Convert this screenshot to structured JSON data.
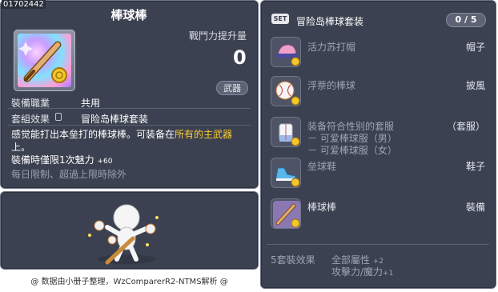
{
  "item_id": "01702442",
  "item": {
    "title": "棒球棒",
    "power_label": "戰鬥力提升量",
    "power_value": "0",
    "weapon_badge": "武器",
    "job_label": "裝備職業",
    "job_value": "共用",
    "set_label": "套組效果",
    "set_value": "冒险岛棒球套装",
    "desc_part1": "感觉能打出本垒打的棒球棒。可装备在",
    "desc_highlight": "所有的主武器",
    "desc_part2": "上。",
    "limit_line": "裝備時僅限1次魅力",
    "limit_bonus": "+60",
    "daily_line": "每日限制、超過上限時除外",
    "credit": "@ 数据由小册子整理，WzComparerR2-NTMS解析 @"
  },
  "set": {
    "badge": "SET",
    "name": "冒险岛棒球套装",
    "count": "0 / 5",
    "items": [
      {
        "name": "活力苏打帽",
        "type": "帽子",
        "icon": "baseball-cap-icon"
      },
      {
        "name": "浮萘的棒球",
        "type": "披風",
        "icon": "baseball-icon"
      },
      {
        "name": "装备符合性别的套服",
        "type": "（套服）",
        "icon": "uniform-icon",
        "sub1": "－ 可爱棒球服（男）",
        "sub2": "－ 可爱棒球服（女）"
      },
      {
        "name": "垒球鞋",
        "type": "鞋子",
        "icon": "sneaker-icon"
      },
      {
        "name": "棒球棒",
        "type": "裝備",
        "icon": "bat-icon"
      }
    ],
    "effect_label": "5套裝效果",
    "effect_line1": "全部屬性",
    "effect_line1_val": "+2",
    "effect_line2": "攻擊力/魔力",
    "effect_line2_val": "+1"
  },
  "colors": {
    "panel": "#3b4150",
    "highlight": "#ffcc33",
    "gold": "#f2c82a"
  }
}
